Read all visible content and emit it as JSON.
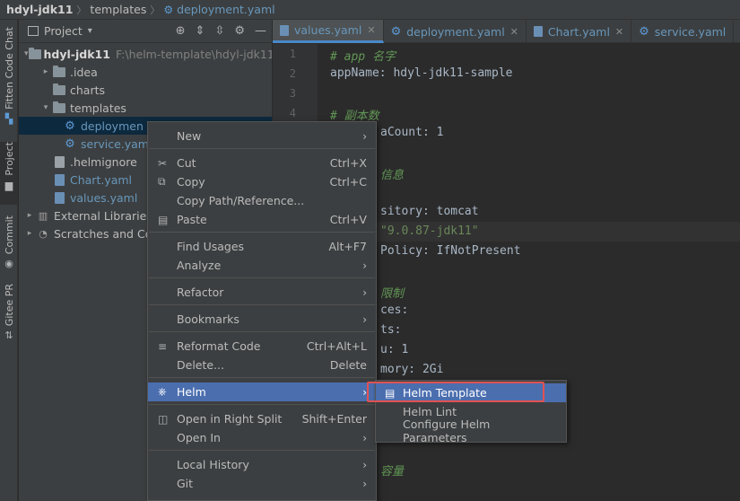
{
  "breadcrumb": {
    "project": "hdyl-jdk11",
    "folder": "templates",
    "file": "deployment.yaml"
  },
  "left_strip": [
    {
      "label": "Fitten Code Chat",
      "icon": "chat-icon"
    },
    {
      "label": "Project",
      "icon": "folder-icon"
    },
    {
      "label": "Commit",
      "icon": "commit-icon"
    },
    {
      "label": "Gitee PR",
      "icon": "pull-request-icon"
    }
  ],
  "project_panel": {
    "title": "Project",
    "tree": [
      {
        "label": "hdyl-jdk11",
        "path": "F:\\helm-template\\hdyl-jdk11",
        "icon": "folder",
        "arrow": "▾"
      },
      {
        "label": ".idea",
        "icon": "folder",
        "arrow": "▸"
      },
      {
        "label": "charts",
        "icon": "folder",
        "arrow": ""
      },
      {
        "label": "templates",
        "icon": "folder",
        "arrow": "▾"
      },
      {
        "label": "deploymen",
        "icon": "gear",
        "arrow": ""
      },
      {
        "label": "service.yam",
        "icon": "gear",
        "arrow": ""
      },
      {
        "label": ".helmignore",
        "icon": "file",
        "arrow": ""
      },
      {
        "label": "Chart.yaml",
        "icon": "yaml",
        "arrow": ""
      },
      {
        "label": "values.yaml",
        "icon": "yaml",
        "arrow": ""
      },
      {
        "label": "External Libraries",
        "icon": "lib",
        "arrow": "▸"
      },
      {
        "label": "Scratches and Co",
        "icon": "lib",
        "arrow": "▸"
      }
    ]
  },
  "tabs": [
    {
      "label": "values.yaml"
    },
    {
      "label": "deployment.yaml"
    },
    {
      "label": "Chart.yaml"
    },
    {
      "label": "service.yaml"
    }
  ],
  "editor": {
    "line_numbers": [
      "1",
      "2",
      "3",
      "4"
    ],
    "lines": [
      {
        "t": "# app 名字"
      },
      {
        "t": "appName: hdyl-jdk11-sample"
      },
      {
        "t": "# 副本数"
      },
      {
        "t": "aCount: 1"
      },
      {
        "t": "信息"
      },
      {
        "t": "sitory: tomcat"
      },
      {
        "t": "\"9.0.87-jdk11\""
      },
      {
        "t": "Policy: IfNotPresent"
      },
      {
        "t": "限制"
      },
      {
        "t": "ces:"
      },
      {
        "t": "ts:"
      },
      {
        "t": "u: 1"
      },
      {
        "t": "mory: 2Gi"
      },
      {
        "t": "容量"
      }
    ]
  },
  "context_menu": {
    "items": [
      {
        "label": "New",
        "shortcut": "",
        "submenu": true,
        "icon": ""
      },
      {
        "label": "Cut",
        "shortcut": "Ctrl+X",
        "icon": "✂"
      },
      {
        "label": "Copy",
        "shortcut": "Ctrl+C",
        "icon": "⧉"
      },
      {
        "label": "Copy Path/Reference...",
        "shortcut": "",
        "icon": ""
      },
      {
        "label": "Paste",
        "shortcut": "Ctrl+V",
        "icon": "▤"
      },
      {
        "label": "Find Usages",
        "shortcut": "Alt+F7",
        "icon": ""
      },
      {
        "label": "Analyze",
        "shortcut": "",
        "submenu": true,
        "icon": ""
      },
      {
        "label": "Refactor",
        "shortcut": "",
        "submenu": true,
        "icon": ""
      },
      {
        "label": "Bookmarks",
        "shortcut": "",
        "submenu": true,
        "icon": ""
      },
      {
        "label": "Reformat Code",
        "shortcut": "Ctrl+Alt+L",
        "icon": "≡"
      },
      {
        "label": "Delete...",
        "shortcut": "Delete",
        "icon": ""
      },
      {
        "label": "Helm",
        "shortcut": "",
        "submenu": true,
        "icon": "⎈"
      },
      {
        "label": "Open in Right Split",
        "shortcut": "Shift+Enter",
        "icon": "◫"
      },
      {
        "label": "Open In",
        "shortcut": "",
        "submenu": true,
        "icon": ""
      },
      {
        "label": "Local History",
        "shortcut": "",
        "submenu": true,
        "icon": ""
      },
      {
        "label": "Git",
        "shortcut": "",
        "submenu": true,
        "icon": ""
      }
    ]
  },
  "helm_submenu": {
    "items": [
      {
        "label": "Helm Template"
      },
      {
        "label": "Helm Lint"
      },
      {
        "label": "Configure Helm Parameters"
      }
    ]
  }
}
